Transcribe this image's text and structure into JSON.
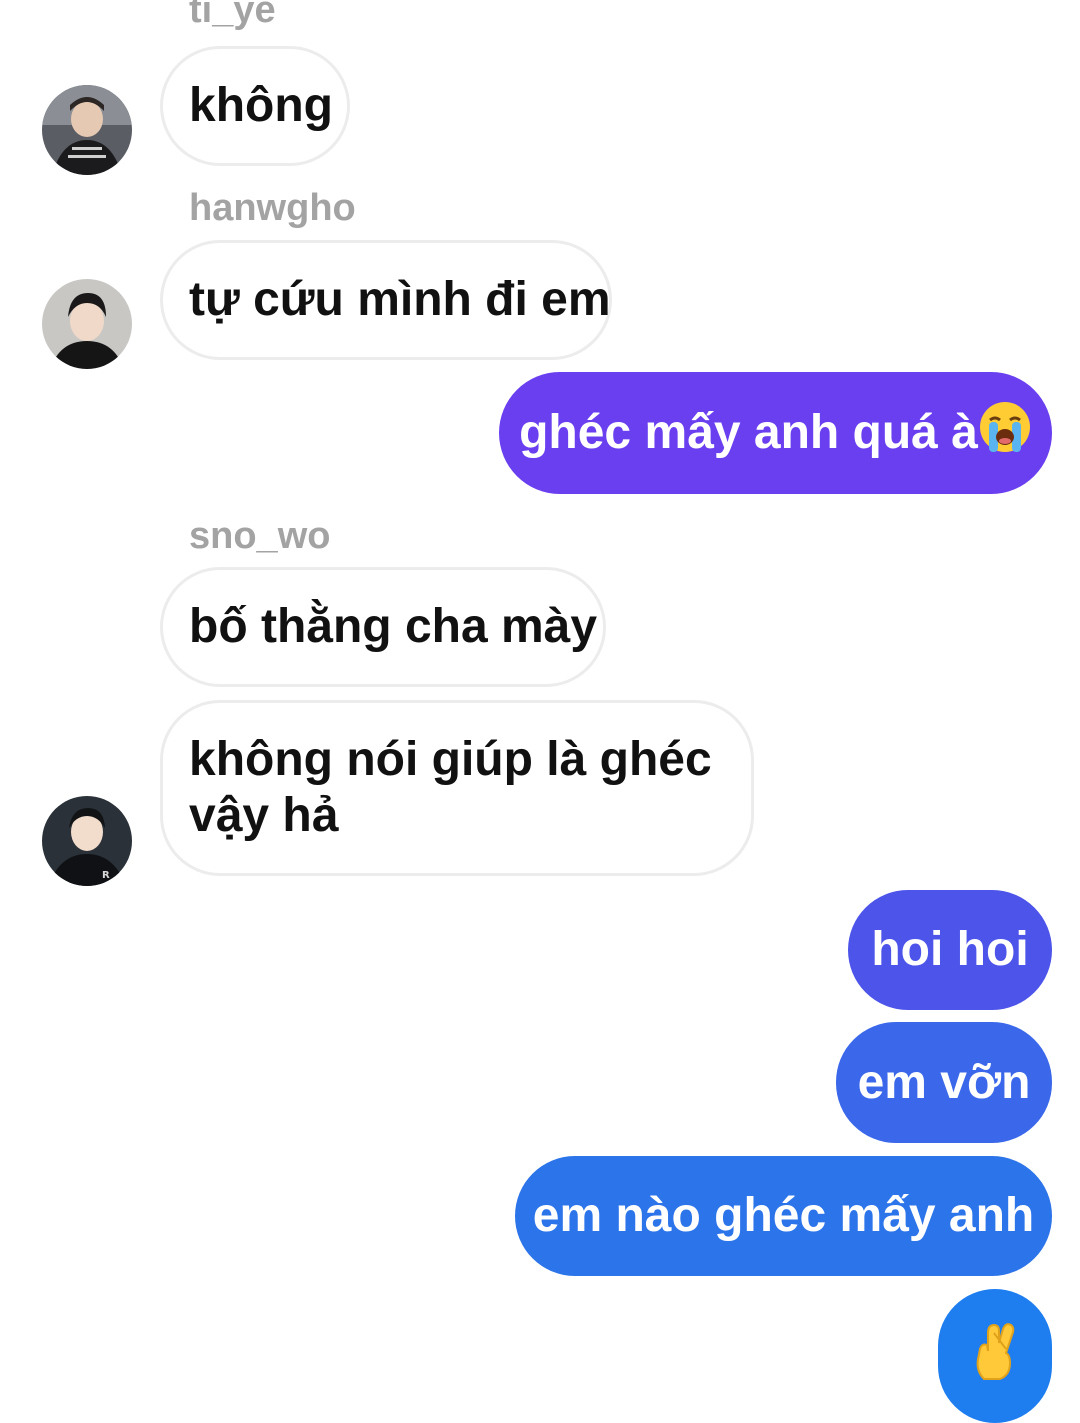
{
  "messages": {
    "m1": {
      "sender": "ti_ye",
      "text": "không"
    },
    "m2": {
      "sender": "hanwgho",
      "text": "tự cứu mình đi em"
    },
    "m3": {
      "text": "ghéc mấy anh quá à",
      "emoji": "loudly-crying-face"
    },
    "m4": {
      "sender": "sno_wo",
      "text": "bố thằng cha mày"
    },
    "m5": {
      "line1": "không nói giúp là ghéc",
      "line2": "vậy hả"
    },
    "m6": {
      "text": "hoi hoi"
    },
    "m7": {
      "text": "em vỡn"
    },
    "m8": {
      "text": "em nào ghéc mấy anh"
    },
    "m9": {
      "emoji": "crossed-fingers"
    }
  },
  "colors": {
    "incoming_bg": "#ffffff",
    "incoming_border": "#ececec",
    "sender_name": "#a3a3a3",
    "outgoing_purple": "#6a3ff0",
    "outgoing_indigo": "#4c54ea",
    "outgoing_blue": "#3b68ea",
    "outgoing_sky": "#2b74ea",
    "outgoing_bright": "#1e7ef0"
  }
}
